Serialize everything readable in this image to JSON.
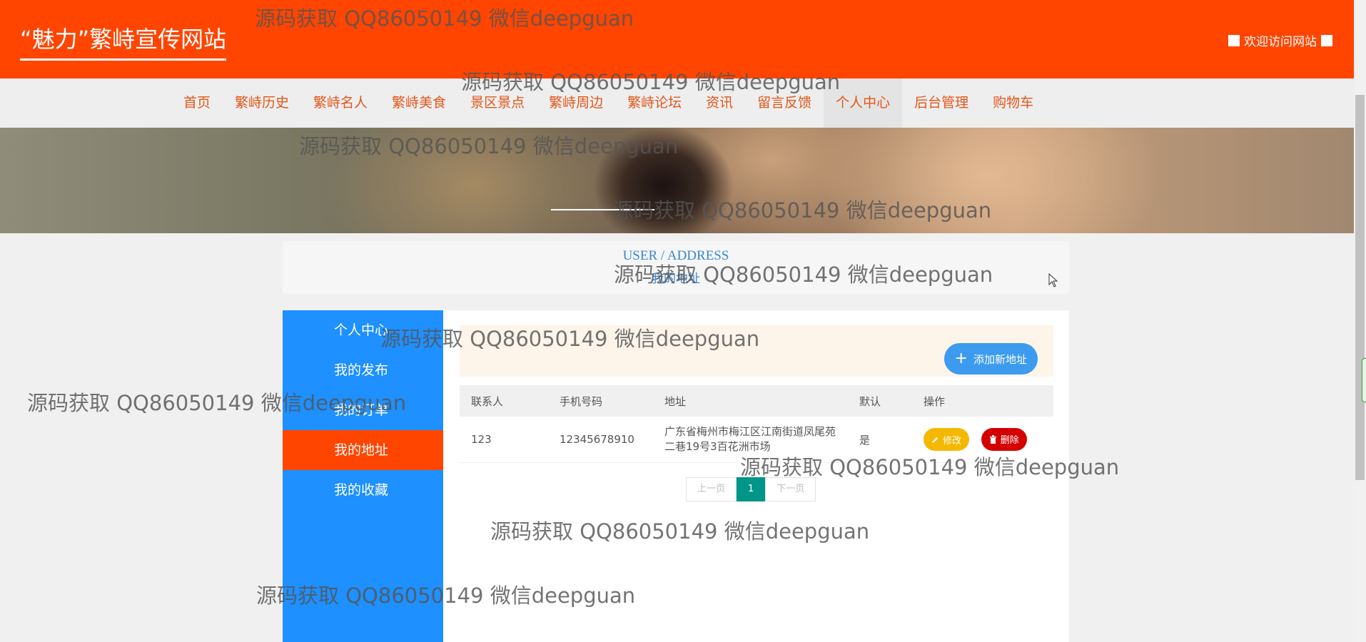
{
  "header": {
    "brand": "“魅力”繁峙宣传网站",
    "welcome": "欢迎访问网站"
  },
  "nav": {
    "items": [
      "首页",
      "繁峙历史",
      "繁峙名人",
      "繁峙美食",
      "景区景点",
      "繁峙周边",
      "繁峙论坛",
      "资讯",
      "留言反馈",
      "个人中心",
      "后台管理",
      "购物车"
    ],
    "active": "个人中心"
  },
  "title": {
    "en": "USER / ADDRESS",
    "cn": "我的地址"
  },
  "sidebar": {
    "items": [
      "个人中心",
      "我的发布",
      "我的订单",
      "我的地址",
      "我的收藏"
    ],
    "active": "我的地址"
  },
  "toolbar": {
    "add_label": "添加新地址"
  },
  "table": {
    "headers": [
      "联系人",
      "手机号码",
      "地址",
      "默认",
      "操作"
    ],
    "rows": [
      {
        "contact": "123",
        "phone": "12345678910",
        "address": "广东省梅州市梅江区江南街道凤尾苑二巷19号3百花洲市场",
        "default": "是"
      }
    ],
    "edit_label": "修改",
    "delete_label": "删除"
  },
  "pager": {
    "prev": "上一页",
    "current": "1",
    "next": "下一页"
  },
  "watermark": "源码获取 QQ86050149 微信deepguan"
}
